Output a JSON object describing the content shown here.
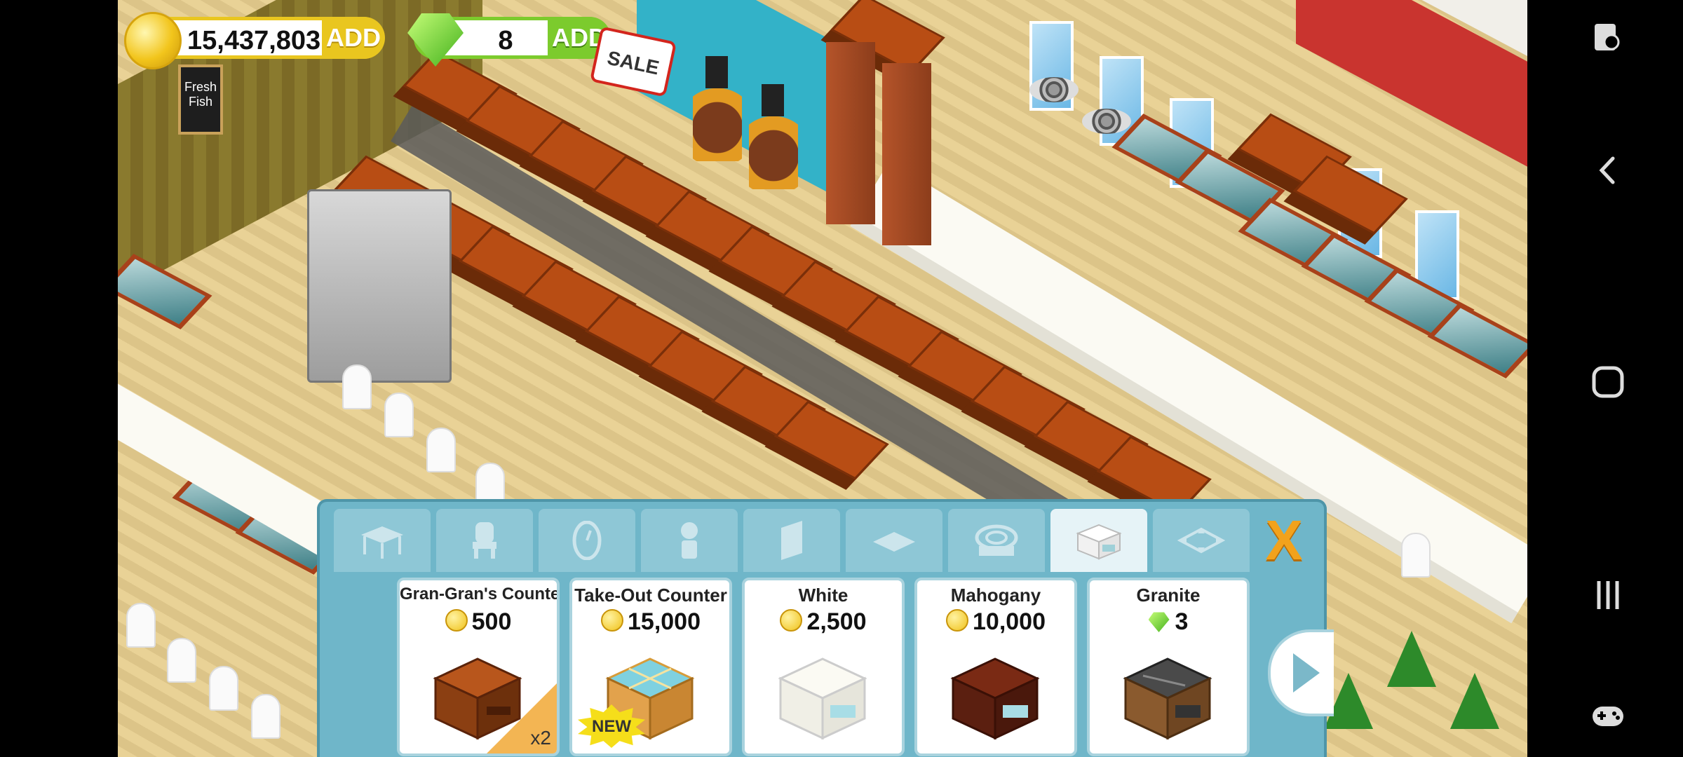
{
  "hud": {
    "coins": "15,437,803",
    "coins_add": "ADD",
    "gems": "8",
    "gems_add": "ADD",
    "sale": "SALE"
  },
  "wall_sign": "Fresh Fish",
  "store": {
    "tabs": [
      {
        "id": "tables",
        "icon": "table-icon"
      },
      {
        "id": "chairs",
        "icon": "chair-icon"
      },
      {
        "id": "wall-decor",
        "icon": "clock-icon"
      },
      {
        "id": "decorations",
        "icon": "plant-icon"
      },
      {
        "id": "walls",
        "icon": "wall-icon"
      },
      {
        "id": "floors",
        "icon": "floor-tile-icon"
      },
      {
        "id": "stoves",
        "icon": "stove-icon"
      },
      {
        "id": "counters",
        "icon": "counter-icon",
        "active": true
      },
      {
        "id": "expansion",
        "icon": "expand-icon"
      }
    ],
    "close": "X",
    "items": [
      {
        "name": "Gran-Gran's Counter",
        "price": "500",
        "currency": "coin",
        "badge": "x2",
        "color": "#8b3f12"
      },
      {
        "name": "Take-Out Counter",
        "price": "15,000",
        "currency": "coin",
        "badge": "NEW",
        "color": "#7fd1e0"
      },
      {
        "name": "White",
        "price": "2,500",
        "currency": "coin",
        "badge": "",
        "color": "#f7f6ef"
      },
      {
        "name": "Mahogany",
        "price": "10,000",
        "currency": "coin",
        "badge": "",
        "color": "#5b1f10"
      },
      {
        "name": "Granite",
        "price": "3",
        "currency": "gem",
        "badge": "",
        "color": "#4a4a4a"
      }
    ]
  },
  "colors": {
    "coin": "#e9c61f",
    "gem": "#7ccb2d",
    "panel": "#6fb6c9",
    "close": "#f2a21c"
  }
}
